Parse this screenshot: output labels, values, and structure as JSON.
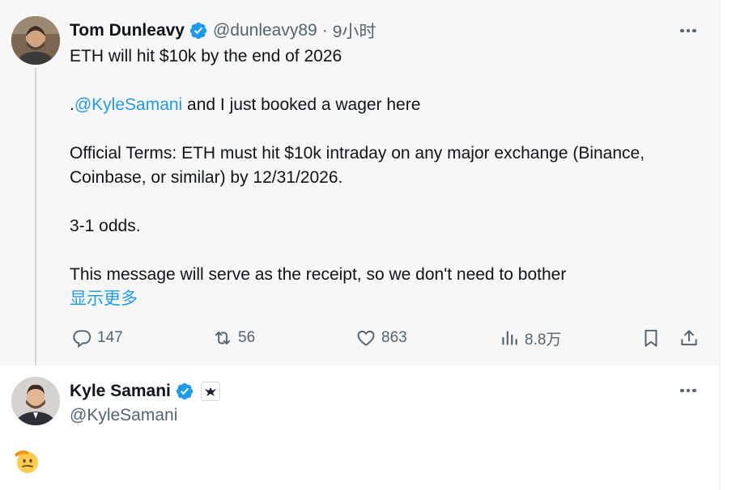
{
  "tweet1": {
    "author_name": "Tom Dunleavy",
    "author_handle": "@dunleavy89",
    "separator": "·",
    "time": "9小时",
    "line1": "ETH will hit $10k by the end of 2026",
    "line2_prefix": ".",
    "line2_mention": "@KyleSamani",
    "line2_suffix": " and I just booked a wager here",
    "line3": "Official Terms: ETH must hit $10k intraday on any major exchange (Binance,",
    "line4": "Coinbase, or similar) by 12/31/2026.",
    "line5": "3-1 odds.",
    "line6": "This message will serve as the receipt, so we don't need to bother",
    "show_more": "显示更多",
    "stats": {
      "replies": "147",
      "reposts": "56",
      "likes": "863",
      "views": "8.8万"
    }
  },
  "tweet2": {
    "author_name": "Kyle Samani",
    "author_handle": "@KyleSamani",
    "content_emoji": "saluting-face-emoji"
  },
  "icons": {
    "verified": "verified-badge-icon",
    "more": "more-options-icon",
    "reply": "reply-icon",
    "repost": "repost-icon",
    "like": "like-icon",
    "views": "views-icon",
    "bookmark": "bookmark-icon",
    "share": "share-icon",
    "org": "affiliation-badge-icon"
  },
  "colors": {
    "link": "#1d9bf0",
    "verified": "#1d9bf0",
    "muted": "#536471",
    "text": "#0f1419",
    "focused_bg": "#f7f7f7"
  }
}
